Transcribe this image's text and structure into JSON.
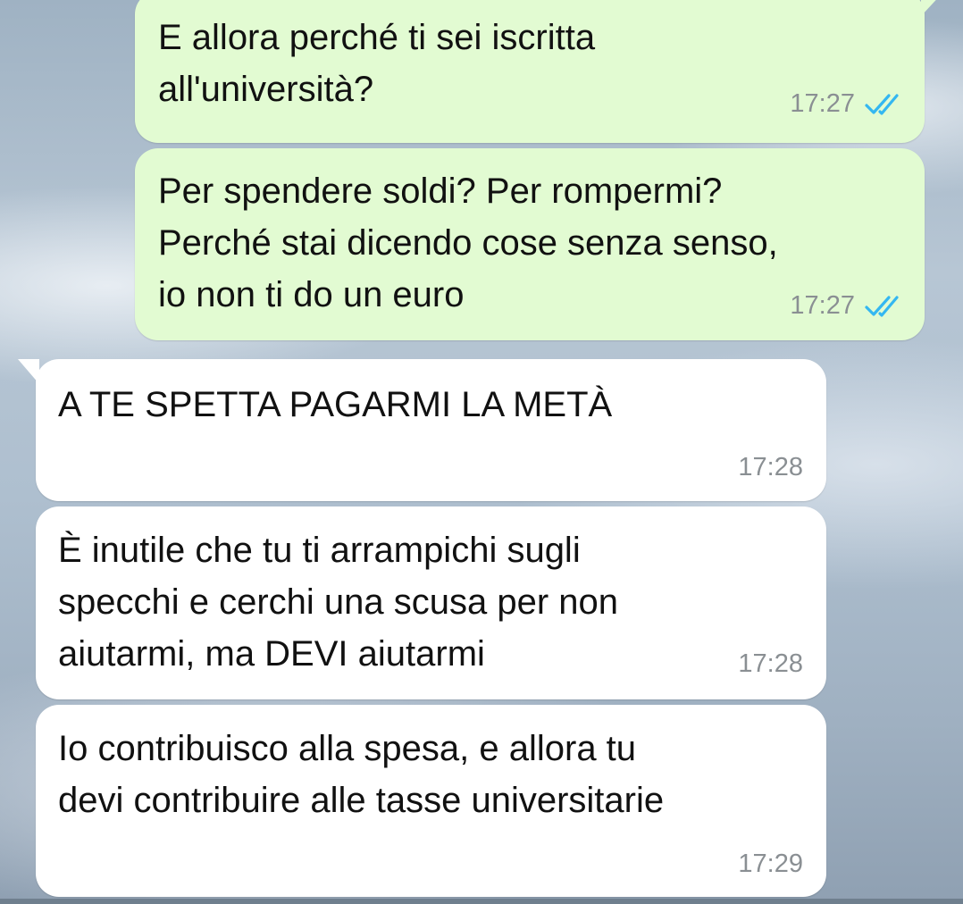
{
  "messages": [
    {
      "direction": "outgoing",
      "text": "E allora perché ti sei iscritta\nall'università?",
      "time": "17:27",
      "status": "double-check-read-icon"
    },
    {
      "direction": "outgoing",
      "text": "Per spendere soldi? Per rompermi?\nPerché stai dicendo cose senza senso,\nio non ti do un euro",
      "time": "17:27",
      "status": "double-check-read-icon"
    },
    {
      "direction": "incoming",
      "text": "A TE SPETTA PAGARMI LA METÀ",
      "time": "17:28"
    },
    {
      "direction": "incoming",
      "text": "È inutile che tu ti arrampichi sugli\nspecchi e cerchi una scusa per non\naiutarmi, ma DEVI aiutarmi",
      "time": "17:28"
    },
    {
      "direction": "incoming",
      "text": "Io contribuisco alla spesa, e allora tu\ndevi contribuire alle tasse universitarie",
      "time": "17:29"
    }
  ],
  "colors": {
    "outgoing_bubble": "#e2fbd2",
    "incoming_bubble": "#ffffff",
    "read_ticks": "#34b7f1",
    "timestamp": "#8a8f93"
  }
}
